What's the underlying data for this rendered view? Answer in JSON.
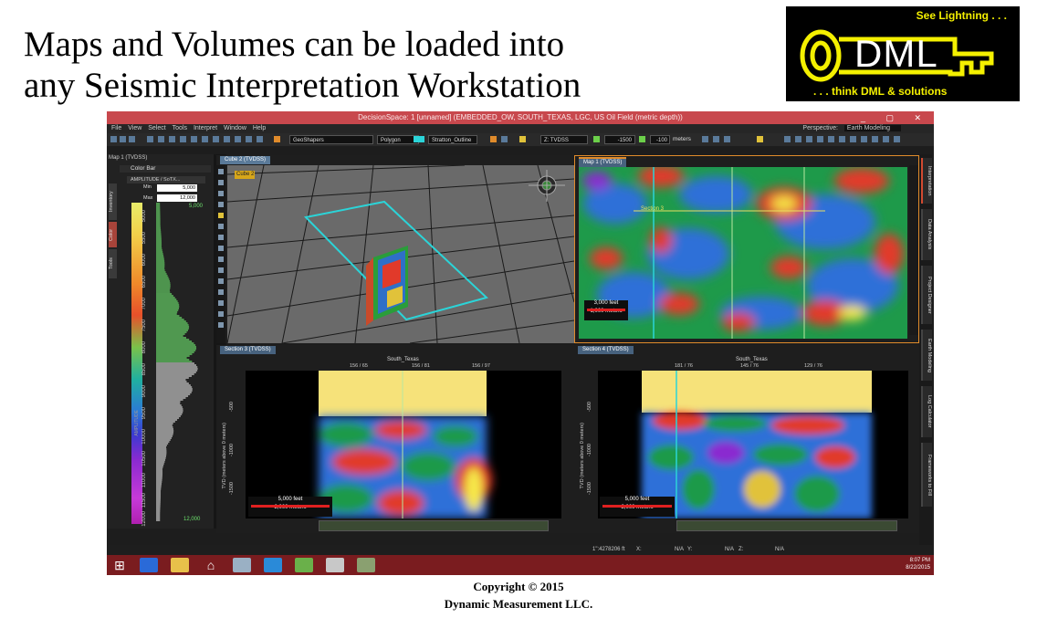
{
  "slide": {
    "title": "Maps and Volumes can be loaded into\nany Seismic Interpretation Workstation",
    "copyright_line1": "Copyright  © 2015",
    "copyright_line2": "Dynamic  Measurement  LLC."
  },
  "logo": {
    "tagline_top": "See Lightning . . .",
    "brand": "DML",
    "tagline_bottom": ". . . think DML & solutions"
  },
  "window": {
    "title": "DecisionSpace: 1 [unnamed] (EMBEDDED_OW, SOUTH_TEXAS, LGC, US Oil Field (metric depth))",
    "menu": [
      "File",
      "View",
      "Select",
      "Tools",
      "Interpret",
      "Window",
      "Help"
    ],
    "perspective_label": "Perspective:",
    "perspective_value": "Earth Modeling",
    "toolbar": {
      "geoshapers": "GeoShapers",
      "polygon": "Polygon",
      "stratton": "Stratton_Outline",
      "domain": "Z: TVDSS",
      "value1": "-1500",
      "value2": "-100",
      "unit": "meters"
    }
  },
  "left_panel": {
    "title": "Map 1 (TVDSS)",
    "colorbar_header": "Color Bar",
    "attribute": "AMPLITUDE / SoTX...",
    "min_label": "Min",
    "min_value": "5,000",
    "max_label": "Max",
    "max_value": "12,000",
    "tabs": [
      "Inventory",
      "Color",
      "Tools"
    ],
    "ticks": [
      "5000",
      "5500",
      "6000",
      "6500",
      "7000",
      "7500",
      "8000",
      "8500",
      "9000",
      "9500",
      "10000",
      "10500",
      "11000",
      "11500",
      "12000"
    ],
    "top_value": "5,000",
    "bottom_value": "12,000",
    "axis_label": "AMPLITUDE"
  },
  "viewports": {
    "cube": {
      "tab": "Cube 2 (TVDSS)",
      "label": "Cube 2"
    },
    "map": {
      "tab": "Map 1 (TVDSS)",
      "section_label": "Section 3",
      "scale_feet": "3,000 feet",
      "scale_meters": "1,000 meters"
    },
    "section3": {
      "tab": "Section 3 (TVDSS)",
      "title": "South_Texas",
      "ticks": [
        "156 / 65",
        "156 / 81",
        "156 / 97"
      ],
      "y_label": "TVD (meters above 0 meters)",
      "y_ticks": [
        "-500",
        "-1000",
        "-1500"
      ],
      "scale_feet": "5,000 feet",
      "scale_meters": "2,000 meters"
    },
    "section4": {
      "tab": "Section 4 (TVDSS)",
      "title": "South_Texas",
      "ticks": [
        "181 / 76",
        "145 / 76",
        "129 / 76"
      ],
      "y_label": "TVD (meters above 0 meters)",
      "y_ticks": [
        "-500",
        "-1000",
        "-1500"
      ],
      "scale_feet": "5,000 feet",
      "scale_meters": "2,000 meters"
    }
  },
  "right_tabs": [
    "Interpretation",
    "Data Analysis",
    "Project Designer",
    "Earth Modeling",
    "Log Calculator",
    "Frameworks to Fill"
  ],
  "status": {
    "coord": "1\":4278206 ft",
    "x_label": "X:",
    "x_value": "N/A",
    "y_label": "Y:",
    "y_value": "N/A",
    "z_label": "Z:",
    "z_value": "N/A"
  },
  "taskbar": {
    "time": "8:07 PM",
    "date": "8/22/2015"
  }
}
